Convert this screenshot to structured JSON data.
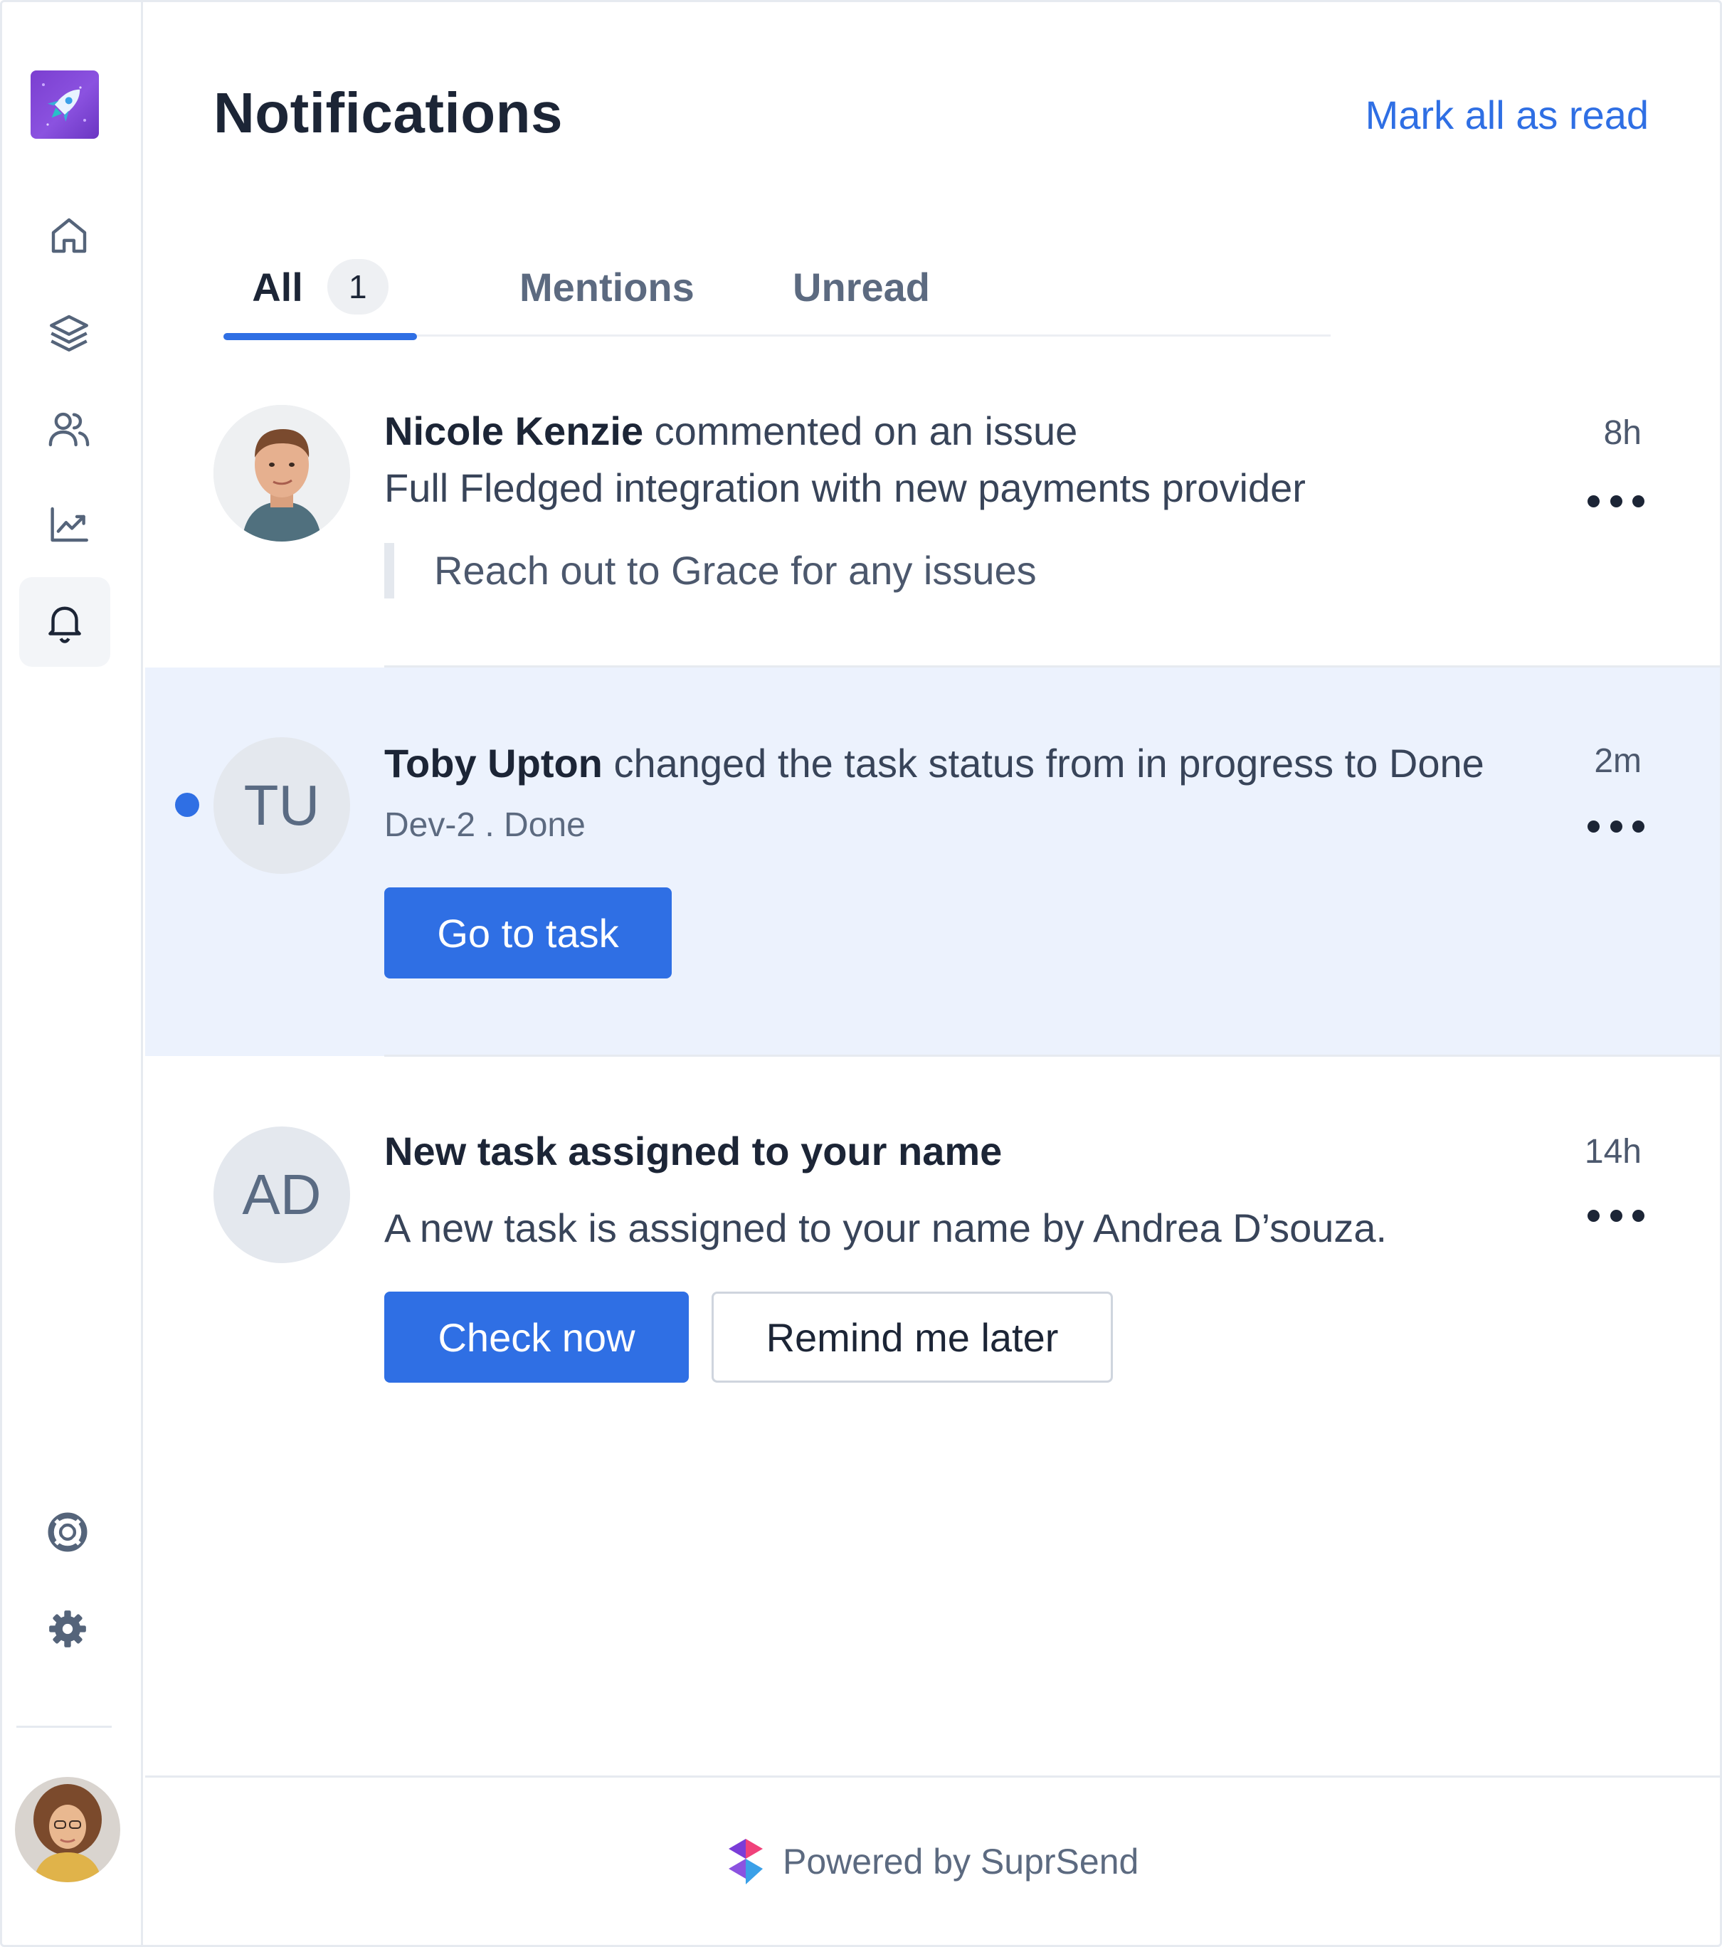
{
  "app": {
    "title": "Notifications",
    "mark_all_label": "Mark all as read",
    "accent_color": "#2f6fe4",
    "unread_bg_color": "#ecf2fd"
  },
  "sidebar": {
    "logo": "rocket-logo",
    "items": [
      {
        "icon": "home-icon"
      },
      {
        "icon": "layers-icon"
      },
      {
        "icon": "users-icon"
      },
      {
        "icon": "chart-icon"
      },
      {
        "icon": "bell-icon",
        "active": true
      }
    ],
    "bottom_items": [
      {
        "icon": "lifebuoy-icon"
      },
      {
        "icon": "gear-icon"
      }
    ],
    "user_avatar": "user-avatar"
  },
  "tabs": [
    {
      "label": "All",
      "badge": "1",
      "active": true
    },
    {
      "label": "Mentions"
    },
    {
      "label": "Unread"
    }
  ],
  "notifications": [
    {
      "actor": "Nicole Kenzie",
      "action": "commented on an issue",
      "subtitle": "Full Fledged integration with new payments provider",
      "quote": "Reach out to Grace for any issues",
      "time": "8h",
      "avatar": "photo"
    },
    {
      "actor": "Toby Upton",
      "action": "changed the task status from in progress to Done",
      "meta": "Dev-2 . Done",
      "time": "2m",
      "avatar_initials": "TU",
      "unread": true,
      "primary_button": "Go to task"
    },
    {
      "title": "New task assigned to your name",
      "body": "A new task is assigned to your name by Andrea D’souza.",
      "time": "14h",
      "avatar_initials": "AD",
      "primary_button": "Check now",
      "secondary_button": "Remind me later"
    }
  ],
  "footer": {
    "powered_by": "Powered by SuprSend"
  }
}
